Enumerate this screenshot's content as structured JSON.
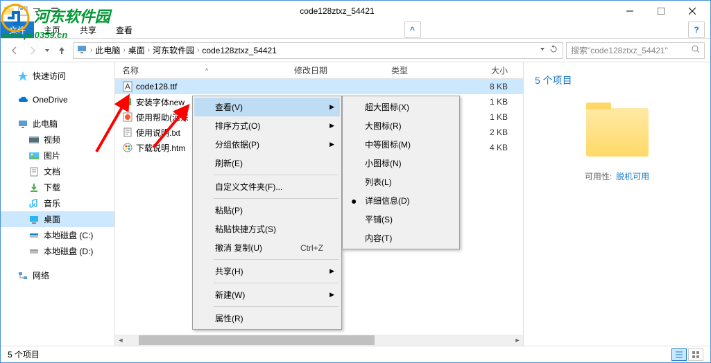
{
  "window": {
    "title": "code128ztxz_54421"
  },
  "ribbon": {
    "file": "文件",
    "tabs": [
      "主页",
      "共享",
      "查看"
    ]
  },
  "breadcrumb": {
    "items": [
      "此电脑",
      "桌面",
      "河东软件园",
      "code128ztxz_54421"
    ]
  },
  "search": {
    "placeholder": "搜索\"code128ztxz_54421\""
  },
  "sidebar": {
    "quick": "快速访问",
    "onedrive": "OneDrive",
    "thispc": "此电脑",
    "video": "视频",
    "pictures": "图片",
    "documents": "文档",
    "downloads": "下载",
    "music": "音乐",
    "desktop": "桌面",
    "diskc": "本地磁盘 (C:)",
    "diskd": "本地磁盘 (D:)",
    "network": "网络"
  },
  "columns": {
    "name": "名称",
    "date": "修改日期",
    "type": "类型",
    "size": "大小"
  },
  "files": [
    {
      "name": "code128.ttf",
      "size": "8 KB",
      "icon": "font"
    },
    {
      "name": "安装字体new",
      "size": "1 KB",
      "icon": "reg"
    },
    {
      "name": "使用帮助(河东",
      "size": "1 KB",
      "icon": "url"
    },
    {
      "name": "使用说明.txt",
      "size": "2 KB",
      "icon": "txt"
    },
    {
      "name": "下载说明.htm",
      "size": "4 KB",
      "icon": "html"
    }
  ],
  "preview": {
    "count": "5 个项目",
    "avail_label": "可用性:",
    "avail_value": "脱机可用"
  },
  "status": {
    "text": "5 个项目"
  },
  "context_menu": {
    "view": "查看(V)",
    "sort": "排序方式(O)",
    "group": "分组依据(P)",
    "refresh": "刷新(E)",
    "customize": "自定义文件夹(F)...",
    "paste": "粘贴(P)",
    "paste_shortcut": "粘贴快捷方式(S)",
    "undo": "撤消 复制(U)",
    "undo_accel": "Ctrl+Z",
    "share": "共享(H)",
    "new": "新建(W)",
    "properties": "属性(R)"
  },
  "submenu": {
    "xlarge": "超大图标(X)",
    "large": "大图标(R)",
    "medium": "中等图标(M)",
    "small": "小图标(N)",
    "list": "列表(L)",
    "details": "详细信息(D)",
    "tiles": "平铺(S)",
    "content": "内容(T)"
  },
  "watermark": {
    "text": "河东软件园",
    "url": "www.pc0359.cn"
  }
}
